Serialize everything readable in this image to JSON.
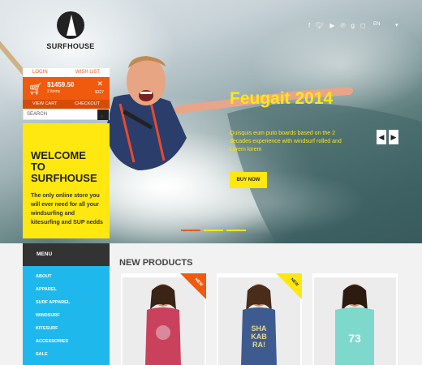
{
  "brand": {
    "name": "SURFHOUSE"
  },
  "header": {
    "social_icons": [
      "facebook-icon",
      "twitter-icon",
      "youtube-icon",
      "pinterest-icon",
      "google-plus-icon",
      "instagram-icon"
    ],
    "language": "EN",
    "dropdown_icon": "chevron-down-icon"
  },
  "account": {
    "login_label": "LOGIN",
    "wishlist_label": "WISH LIST"
  },
  "cart": {
    "total": "$1459.50",
    "items": "2 items",
    "price": "$327",
    "view_cart_label": "VIEW CART",
    "checkout_label": "CHECKOUT"
  },
  "search": {
    "placeholder": "SEARCH"
  },
  "welcome": {
    "title": "WELCOME TO SURFHOUSE",
    "text": "The only online store you will ever need for all your windsurfing and kitesurfing and SUP nedds"
  },
  "slide": {
    "title": "Feugait 2014",
    "text": "Quisquis eum puto boards based on the 2 decades experience with windsurf rolled and Lorem lorem",
    "button_label": "BUY NOW",
    "dots": [
      "#f05a0f",
      "#ffe710",
      "#ffe710"
    ]
  },
  "menu": {
    "title": "MENU",
    "items": [
      "ABOUT",
      "APPAREL",
      "SURF APPAREL",
      "WINDSURF",
      "KITESURF",
      "ACCESSORIES",
      "SALE"
    ]
  },
  "products": {
    "title": "NEW PRODUCTS",
    "items": [
      {
        "badge": "NEW",
        "badge_color": "orange",
        "shirt_color": "#c9415d"
      },
      {
        "badge": "NEW",
        "badge_color": "yellow",
        "shirt_color": "#3d5b8f"
      },
      {
        "badge": "",
        "badge_color": "",
        "shirt_color": "#7fd8cc"
      }
    ]
  },
  "colors": {
    "accent_orange": "#f05a0f",
    "accent_yellow": "#ffe710",
    "menu_blue": "#1fb8ec"
  }
}
